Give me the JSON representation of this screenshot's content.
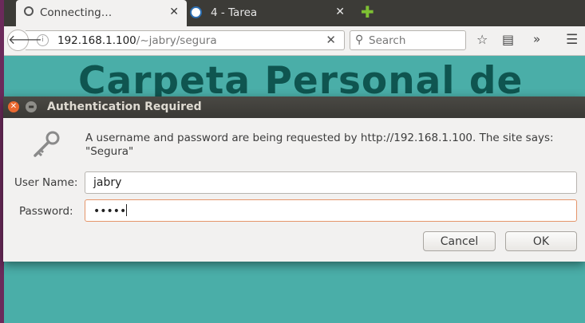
{
  "tabs": [
    {
      "label": "Connecting…",
      "icon": "loading-spinner-icon",
      "close": "✕"
    },
    {
      "label": "4 - Tarea",
      "icon": "site-favicon-icon",
      "close": "✕"
    }
  ],
  "new_tab": "✚",
  "urlbar": {
    "host": "192.168.1.100",
    "path": "/~jabry/segura",
    "clear": "✕"
  },
  "search": {
    "placeholder": "Search"
  },
  "page": {
    "heading": "Carpeta Personal de"
  },
  "dialog": {
    "title": "Authentication Required",
    "message": "A username and password are being requested by http://192.168.1.100. The site says: \"Segura\"",
    "username_label": "User Name:",
    "username_value": "jabry",
    "password_label": "Password:",
    "password_mask": "•••••",
    "cancel_label": "Cancel",
    "ok_label": "OK"
  },
  "colors": {
    "page_bg": "#4aaea8",
    "heading": "#0f5550",
    "close_button": "#e9682f"
  }
}
